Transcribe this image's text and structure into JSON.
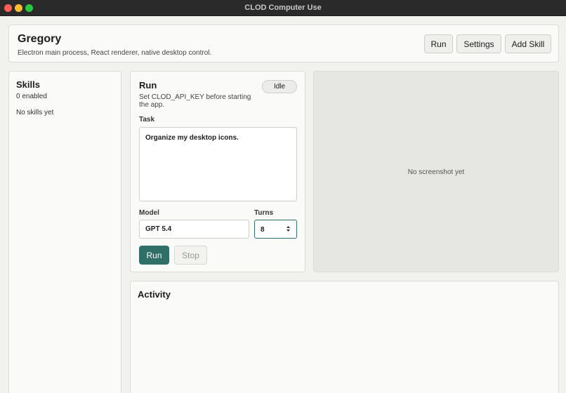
{
  "window": {
    "title": "CLOD Computer Use"
  },
  "header": {
    "title": "Gregory",
    "subtitle": "Electron main process, React renderer, native desktop control.",
    "run_label": "Run",
    "settings_label": "Settings",
    "add_skill_label": "Add Skill"
  },
  "skills": {
    "title": "Skills",
    "count_text": "0 enabled",
    "empty_text": "No skills yet"
  },
  "run_panel": {
    "title": "Run",
    "hint": "Set CLOD_API_KEY before starting the app.",
    "status": "Idle",
    "task_label": "Task",
    "task_value": "Organize my desktop icons.",
    "model_label": "Model",
    "model_value": "GPT 5.4",
    "turns_label": "Turns",
    "turns_value": "8",
    "run_label": "Run",
    "stop_label": "Stop"
  },
  "preview": {
    "empty_text": "No screenshot yet"
  },
  "activity": {
    "title": "Activity"
  },
  "colors": {
    "accent": "#2f6f68",
    "titlebar": "#2a2a2a",
    "close": "#fe5f57",
    "minimize": "#febc2e",
    "maximize": "#28c840"
  }
}
